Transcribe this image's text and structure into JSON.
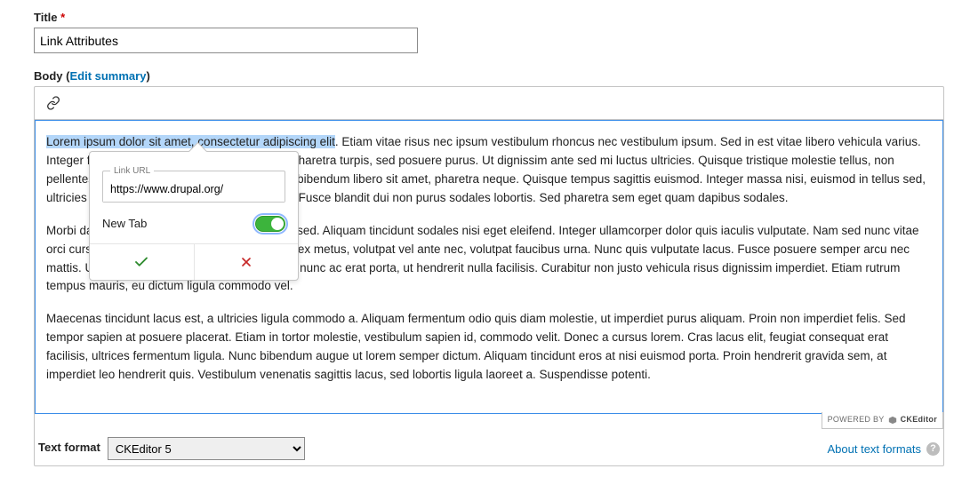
{
  "title": {
    "label": "Title",
    "value": "Link Attributes"
  },
  "body": {
    "label": "Body",
    "paren_open": "(",
    "edit_summary": "Edit summary",
    "paren_close": ")",
    "paragraphs": {
      "p1_link": "Lorem ipsum dolor sit amet, consectetur adipiscing elit",
      "p1_rest": ". Etiam vitae risus nec ipsum vestibulum rhoncus nec vestibulum ipsum. Sed in est vitae libero vehicula varius. Integer facilisis adipiscing nulla. Phasellus vel pharetra turpis, sed posuere purus. Ut dignissim ante sed mi luctus ultricies. Quisque tristique molestie tellus, non pellentesque velit tempor a. Nulla a nisi varius, bibendum libero sit amet, pharetra neque. Quisque tempus sagittis euismod. Integer massa nisi, euismod in tellus sed, ultricies tincidunt justo. Mauris sed posuere mi. Fusce blandit dui non purus sodales lobortis. Sed pharetra sem eget quam dapibus sodales.",
      "p2": "Morbi dapibus sagittis dolor, bibendum gravida sed. Aliquam tincidunt sodales nisi eget eleifend. Integer ullamcorper dolor quis iaculis vulputate. Nam sed nunc vitae orci cursus ornare. In sodales eu feugiat. Proin ex metus, volutpat vel ante nec, volutpat faucibus urna. Nunc quis vulputate lacus. Fusce posuere semper arcu nec mattis. Ut quam felis. Fusce nec ex. Sed varius nunc ac erat porta, ut hendrerit nulla facilisis. Curabitur non justo vehicula risus dignissim imperdiet. Etiam rutrum tempus mauris, eu dictum ligula commodo vel.",
      "p3": "Maecenas tincidunt lacus est, a ultricies ligula commodo a. Aliquam fermentum odio quis diam molestie, ut imperdiet purus aliquam. Proin non imperdiet felis. Sed tempor sapien at posuere placerat. Etiam in tortor molestie, vestibulum sapien id, commodo velit. Donec a cursus lorem. Cras lacus elit, feugiat consequat erat facilisis, ultrices fermentum ligula. Nunc bibendum augue ut lorem semper dictum. Aliquam tincidunt eros at nisi euismod porta. Proin hendrerit gravida sem, at imperdiet leo hendrerit quis. Vestibulum venenatis sagittis lacus, sed lobortis ligula laoreet a. Suspendisse potenti."
    }
  },
  "balloon": {
    "legend": "Link URL",
    "url": "https://www.drupal.org/",
    "newtab_label": "New Tab"
  },
  "powered_by": {
    "prefix": "POWERED BY",
    "brand": "CKEditor"
  },
  "footer": {
    "format_label": "Text format",
    "format_value": "CKEditor 5",
    "about": "About text formats"
  }
}
